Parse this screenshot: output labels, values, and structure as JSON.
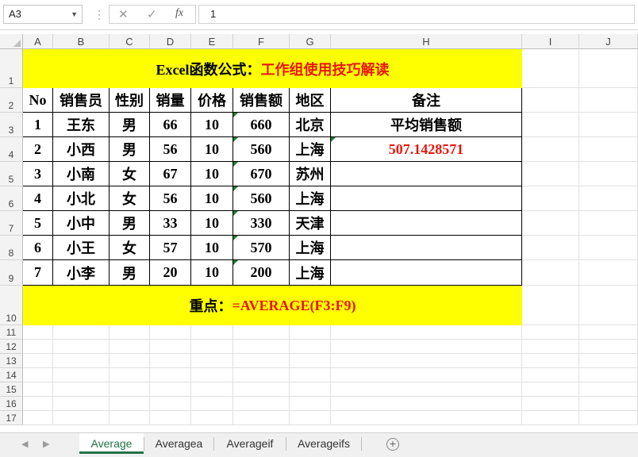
{
  "formula_bar": {
    "name_box": "A3",
    "cancel_glyph": "✕",
    "enter_glyph": "✓",
    "fx_glyph": "fx",
    "formula": "1"
  },
  "columns": [
    "A",
    "B",
    "C",
    "D",
    "E",
    "F",
    "G",
    "H",
    "I",
    "J"
  ],
  "rows": [
    "1",
    "2",
    "3",
    "4",
    "5",
    "6",
    "7",
    "8",
    "9",
    "10",
    "11",
    "12",
    "13",
    "14",
    "15",
    "16",
    "17"
  ],
  "title": {
    "black": "Excel函数公式：",
    "red": "工作组使用技巧解读"
  },
  "table": {
    "headers": [
      "No",
      "销售员",
      "性别",
      "销量",
      "价格",
      "销售额",
      "地区",
      "备注"
    ],
    "rows": [
      [
        "1",
        "王东",
        "男",
        "66",
        "10",
        "660",
        "北京"
      ],
      [
        "2",
        "小西",
        "男",
        "56",
        "10",
        "560",
        "上海"
      ],
      [
        "3",
        "小南",
        "女",
        "67",
        "10",
        "670",
        "苏州"
      ],
      [
        "4",
        "小北",
        "女",
        "56",
        "10",
        "560",
        "上海"
      ],
      [
        "5",
        "小中",
        "男",
        "33",
        "10",
        "330",
        "天津"
      ],
      [
        "6",
        "小王",
        "女",
        "57",
        "10",
        "570",
        "上海"
      ],
      [
        "7",
        "小李",
        "男",
        "20",
        "10",
        "200",
        "上海"
      ]
    ],
    "note_label": "平均销售额",
    "note_value": "507.1428571"
  },
  "footer": {
    "black": "重点：",
    "red": "=AVERAGE(F3:F9)"
  },
  "sheet_tabs": [
    "Average",
    "Averagea",
    "Averageif",
    "Averageifs"
  ],
  "active_sheet": "Average",
  "colors": {
    "highlight": "#ffff00",
    "accent_red": "#e8160c",
    "excel_green": "#217346"
  }
}
